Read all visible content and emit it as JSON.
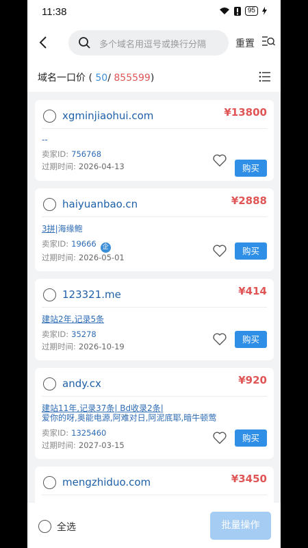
{
  "status_bar": {
    "time": "11:38",
    "battery": "95"
  },
  "header": {
    "search_placeholder": "多个域名用逗号或换行分隔",
    "reset_label": "重置"
  },
  "summary": {
    "title": "域名一口价",
    "open_paren": "(",
    "count": "50",
    "slash": "/",
    "total": "855599",
    "close_paren": ")"
  },
  "labels": {
    "seller_id": "卖家ID:",
    "expires": "过期时间:",
    "buy": "购买",
    "enterprise_badge": "企"
  },
  "cards": [
    {
      "domain": "xgminjiaohui.com",
      "price": "¥13800",
      "tags": "--",
      "desc": "",
      "seller_id": "756768",
      "expires": "2026-04-13"
    },
    {
      "domain": "haiyuanbao.cn",
      "price": "¥2888",
      "tags_link": "3拼",
      "tags_rest": "|海缘鲍",
      "desc": "",
      "seller_id": "19666",
      "expires": "2026-05-01"
    },
    {
      "domain": "123321.me",
      "price": "¥414",
      "tags": "建站2年,记录5条",
      "desc": "",
      "seller_id": "35278",
      "expires": "2026-10-19"
    },
    {
      "domain": "andy.cx",
      "price": "¥920",
      "tags": "建站11年,记录37条| Bd收录2条|",
      "desc": "爱你的呀,奥能电源,阿难对日,阿泥底耶,暗牛顿莺",
      "seller_id": "1325460",
      "expires": "2027-03-15"
    },
    {
      "domain": "mengzhiduo.com",
      "price": "¥3450"
    }
  ],
  "footer": {
    "select_all": "全选",
    "batch_label": "批量操作"
  },
  "colors": {
    "accent": "#2f8fe6",
    "price": "#e05555",
    "link": "#2d6bb5"
  }
}
